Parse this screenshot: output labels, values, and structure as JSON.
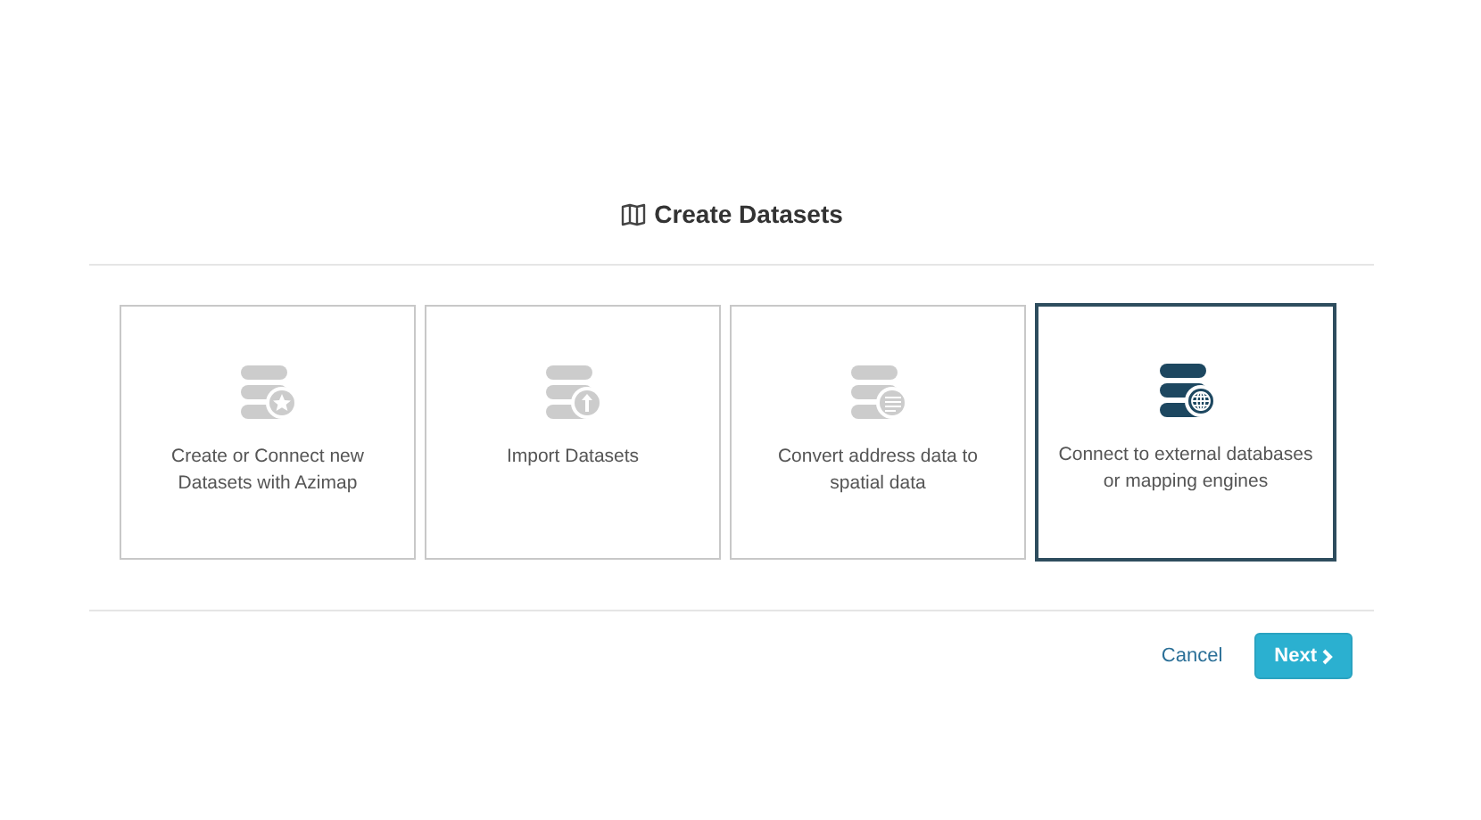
{
  "dialog": {
    "title": "Create Datasets"
  },
  "options": [
    {
      "kind": "star",
      "label": "Create or Connect new Datasets with Azimap",
      "selected": false
    },
    {
      "kind": "upload",
      "label": "Import Datasets",
      "selected": false
    },
    {
      "kind": "lines",
      "label": "Convert address data to spatial data",
      "selected": false
    },
    {
      "kind": "globe",
      "label": "Connect to external databases or mapping engines",
      "selected": true
    }
  ],
  "buttons": {
    "cancel": "Cancel",
    "next": "Next"
  }
}
